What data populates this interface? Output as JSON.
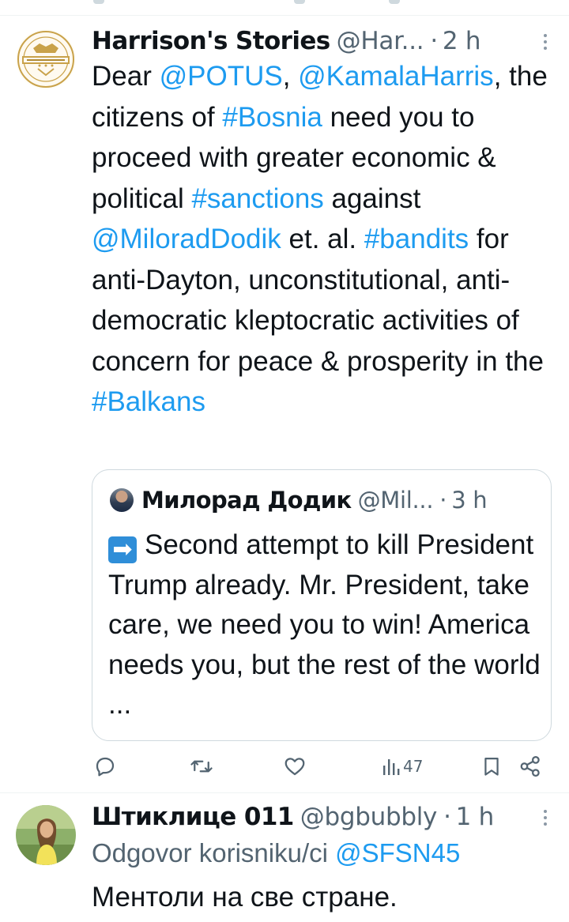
{
  "tweet1": {
    "author_name": "Harrison's Stories",
    "author_handle": "@Har...",
    "separator": "·",
    "time": "2 h",
    "avatar_icon": "harrisons-stories-logo",
    "text_segments": [
      {
        "text": "Dear ",
        "type": "text"
      },
      {
        "text": "@POTUS",
        "type": "link"
      },
      {
        "text": ", ",
        "type": "text"
      },
      {
        "text": "@KamalaHarris",
        "type": "link"
      },
      {
        "text": ", the citizens of ",
        "type": "text"
      },
      {
        "text": "#Bosnia",
        "type": "link"
      },
      {
        "text": " need you to proceed with greater economic & political ",
        "type": "text"
      },
      {
        "text": "#sanctions",
        "type": "link"
      },
      {
        "text": " against ",
        "type": "text"
      },
      {
        "text": "@MiloradDodik",
        "type": "link"
      },
      {
        "text": " et. al. ",
        "type": "text"
      },
      {
        "text": "#bandits",
        "type": "link"
      },
      {
        "text": " for anti-Dayton, unconstitutional, anti-democratic kleptocratic activities of concern for peace & prosperity in the ",
        "type": "text"
      },
      {
        "text": "#Balkans",
        "type": "link"
      }
    ],
    "quote": {
      "author_name": "Милорад Додик",
      "author_handle": "@Mil...",
      "separator": "·",
      "time": "3 h",
      "emoji": "➡",
      "text": "Second attempt to kill President Trump already. Mr. President, take care, we need you to win!  America needs you, but the rest of the world ..."
    },
    "actions": {
      "views_count": "47"
    }
  },
  "tweet2": {
    "author_name": "Штиклице 011",
    "author_handle": "@bgbubbly",
    "separator": "·",
    "time": "1 h",
    "reply_to_prefix": "Odgovor korisniku/ci ",
    "reply_to_handle": "@SFSN45",
    "text": "Ментоли на све стране."
  },
  "colors": {
    "link": "#1d9bf0",
    "secondary_text": "#536471",
    "primary_text": "#0f1419",
    "border": "#cfd9de"
  }
}
